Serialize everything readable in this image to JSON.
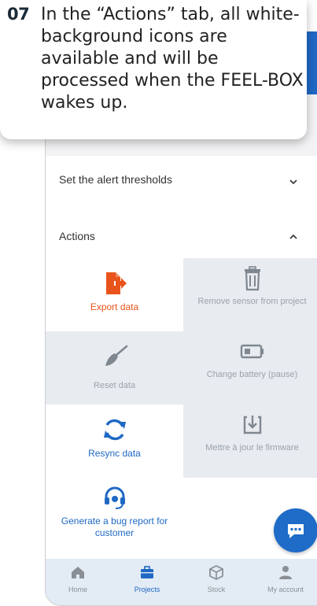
{
  "callout": {
    "step": "07",
    "text": "In the “Actions” tab, all white-background icons are available and will be processed when the FEEL-BOX wakes up."
  },
  "thresholds": {
    "title": "Set the alert thresholds",
    "state": "collapsed"
  },
  "actions": {
    "title": "Actions",
    "state": "expanded",
    "tiles": [
      {
        "label": "Export data",
        "icon": "export-icon",
        "available": true
      },
      {
        "label": "Remove sensor from project",
        "icon": "trash-icon",
        "available": false
      },
      {
        "label": "Reset data",
        "icon": "broom-icon",
        "available": false
      },
      {
        "label": "Change battery (pause)",
        "icon": "battery-icon",
        "available": false
      },
      {
        "label": "Resync data",
        "icon": "sync-icon",
        "available": true
      },
      {
        "label": "Mettre à jour le firmware",
        "icon": "firmware-download-icon",
        "available": false
      },
      {
        "label": "Generate a bug report for customer",
        "icon": "headset-icon",
        "available": true
      }
    ]
  },
  "fab": {
    "icon": "chat-icon"
  },
  "bottom_nav": {
    "items": [
      {
        "label": "Home",
        "icon": "home-icon",
        "active": false
      },
      {
        "label": "Projects",
        "icon": "briefcase-icon",
        "active": true
      },
      {
        "label": "Stock",
        "icon": "box-icon",
        "active": false
      },
      {
        "label": "My account",
        "icon": "user-icon",
        "active": false
      }
    ]
  },
  "colors": {
    "primary": "#1f68c4",
    "export_accent": "#e8541c",
    "disabled_tile": "#e8ebef",
    "disabled_text": "#9aa3ad",
    "nav_background": "#e3ebf4"
  }
}
